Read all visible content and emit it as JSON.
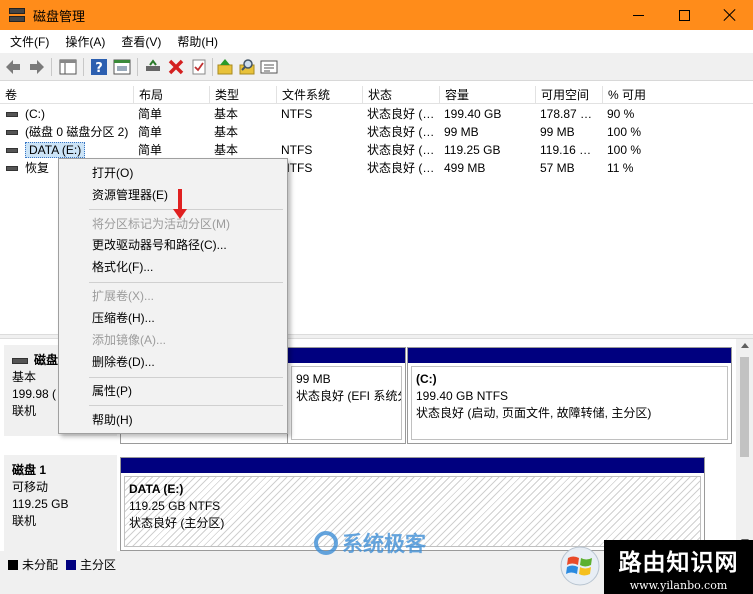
{
  "window": {
    "title": "磁盘管理"
  },
  "menu": [
    "文件(F)",
    "操作(A)",
    "查看(V)",
    "帮助(H)"
  ],
  "columns": [
    "卷",
    "布局",
    "类型",
    "文件系统",
    "状态",
    "容量",
    "可用空间",
    "% 可用"
  ],
  "volumes": [
    {
      "name": "(C:)",
      "layout": "简单",
      "type": "基本",
      "fs": "NTFS",
      "status": "状态良好 (…",
      "capacity": "199.40 GB",
      "free": "178.87 …",
      "pct": "90 %"
    },
    {
      "name": "(磁盘 0 磁盘分区 2)",
      "layout": "简单",
      "type": "基本",
      "fs": "",
      "status": "状态良好 (…",
      "capacity": "99 MB",
      "free": "99 MB",
      "pct": "100 %"
    },
    {
      "name": "DATA (E:)",
      "layout": "简单",
      "type": "基本",
      "fs": "NTFS",
      "status": "状态良好 (…",
      "capacity": "119.25 GB",
      "free": "119.16 …",
      "pct": "100 %"
    },
    {
      "name": "恢复",
      "layout": "简单",
      "type": "基本",
      "fs": "NTFS",
      "status": "状态良好 (…",
      "capacity": "499 MB",
      "free": "57 MB",
      "pct": "11 %"
    }
  ],
  "context_menu": [
    {
      "label": "打开(O)",
      "enabled": true
    },
    {
      "label": "资源管理器(E)",
      "enabled": true
    },
    {
      "label": "将分区标记为活动分区(M)",
      "enabled": false
    },
    {
      "label": "更改驱动器号和路径(C)...",
      "enabled": true
    },
    {
      "label": "格式化(F)...",
      "enabled": true
    },
    {
      "label": "扩展卷(X)...",
      "enabled": false
    },
    {
      "label": "压缩卷(H)...",
      "enabled": true
    },
    {
      "label": "添加镜像(A)...",
      "enabled": false
    },
    {
      "label": "删除卷(D)...",
      "enabled": true
    },
    {
      "label": "属性(P)",
      "enabled": true
    },
    {
      "label": "帮助(H)",
      "enabled": true
    }
  ],
  "disk0": {
    "name": "磁盘",
    "kind": "基本",
    "size": "199.98 (",
    "state": "联机",
    "partitions": [
      {
        "title": "",
        "size": "99 MB",
        "status": "状态良好 (EFI 系统分"
      },
      {
        "title": "(C:)",
        "size": "199.40 GB NTFS",
        "status": "状态良好 (启动, 页面文件, 故障转储, 主分区)"
      }
    ]
  },
  "disk1": {
    "name": "磁盘 1",
    "kind": "可移动",
    "size": "119.25 GB",
    "state": "联机",
    "partitions": [
      {
        "title": "DATA  (E:)",
        "size": "119.25 GB NTFS",
        "status": "状态良好 (主分区)"
      }
    ]
  },
  "legend": [
    {
      "label": "未分配",
      "color": "#000000"
    },
    {
      "label": "主分区",
      "color": "#00007f"
    }
  ],
  "colors": {
    "titlebar": "#ff8c1a",
    "partition_bar": "#00007f",
    "arrow": "#e02020"
  },
  "watermark": {
    "text": "系统极客"
  },
  "brand": {
    "name": "路由知识网",
    "url": "www.yilanbo.com"
  }
}
